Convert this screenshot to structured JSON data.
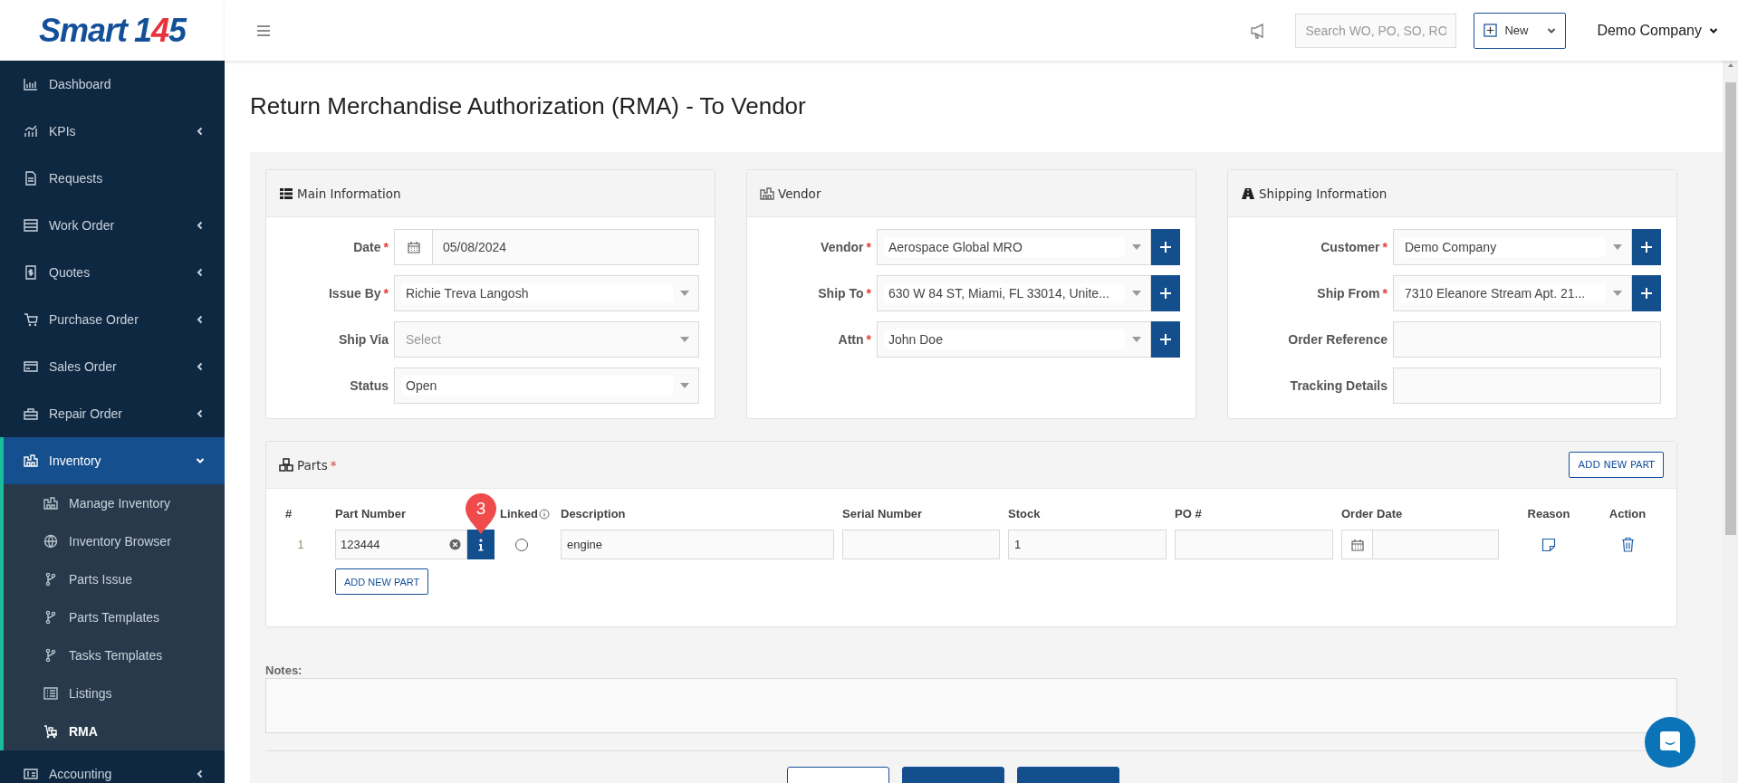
{
  "logo": {
    "word": "Smart",
    "number": "145"
  },
  "sidebar": {
    "items": [
      {
        "label": "Dashboard",
        "has_submenu": false,
        "selected": false
      },
      {
        "label": "KPIs",
        "has_submenu": true,
        "expanded": false,
        "selected": false
      },
      {
        "label": "Requests",
        "has_submenu": false,
        "selected": false
      },
      {
        "label": "Work Order",
        "has_submenu": true,
        "expanded": false,
        "selected": false
      },
      {
        "label": "Quotes",
        "has_submenu": true,
        "expanded": false,
        "selected": false
      },
      {
        "label": "Purchase Order",
        "has_submenu": true,
        "expanded": false,
        "selected": false
      },
      {
        "label": "Sales Order",
        "has_submenu": true,
        "expanded": false,
        "selected": false
      },
      {
        "label": "Repair Order",
        "has_submenu": true,
        "expanded": false,
        "selected": false
      },
      {
        "label": "Inventory",
        "has_submenu": true,
        "expanded": true,
        "selected": true,
        "children": [
          {
            "label": "Manage Inventory",
            "selected": false
          },
          {
            "label": "Inventory Browser",
            "selected": false
          },
          {
            "label": "Parts Issue",
            "selected": false
          },
          {
            "label": "Parts Templates",
            "selected": false
          },
          {
            "label": "Tasks Templates",
            "selected": false
          },
          {
            "label": "Listings",
            "selected": false
          },
          {
            "label": "RMA",
            "selected": true
          }
        ]
      },
      {
        "label": "Accounting",
        "has_submenu": true,
        "expanded": false,
        "selected": false
      }
    ]
  },
  "topbar": {
    "search": {
      "placeholder": "Search WO, PO, SO, RO"
    },
    "new_button": "New",
    "company": "Demo Company"
  },
  "page_title": "Return Merchandise Authorization (RMA) - To Vendor",
  "sections": [
    {
      "title": "Main Information",
      "fields": [
        {
          "label": "Date",
          "required_mark": "*",
          "kind": "date",
          "value": "05/08/2024",
          "has_add": false
        },
        {
          "label": "Issue By",
          "required_mark": "*",
          "kind": "select",
          "value": "Richie Treva Langosh",
          "has_add": false
        },
        {
          "label": "Ship Via",
          "kind": "select",
          "placeholder": "Select",
          "has_add": false
        },
        {
          "label": "Status",
          "kind": "select",
          "value": "Open",
          "has_add": false
        }
      ]
    },
    {
      "title": "Vendor",
      "fields": [
        {
          "label": "Vendor",
          "required_mark": "*",
          "kind": "select",
          "value": "Aerospace Global MRO",
          "has_add": true
        },
        {
          "label": "Ship To",
          "required_mark": "*",
          "kind": "select",
          "value": "630 W 84 ST, Miami, FL 33014, Unite...",
          "has_add": true
        },
        {
          "label": "Attn",
          "required_mark": "*",
          "kind": "select",
          "value": "John Doe",
          "has_add": true
        }
      ]
    },
    {
      "title": "Shipping Information",
      "fields": [
        {
          "label": "Customer",
          "required_mark": "*",
          "kind": "select",
          "value": "Demo Company",
          "has_add": true
        },
        {
          "label": "Ship From",
          "required_mark": "*",
          "kind": "select",
          "value": "7310 Eleanore Stream Apt. 21...",
          "has_add": true
        },
        {
          "label": "Order Reference",
          "kind": "text",
          "has_add": false
        },
        {
          "label": "Tracking Details",
          "kind": "text",
          "has_add": false
        }
      ]
    }
  ],
  "parts": {
    "title": "Parts",
    "required_mark": "*",
    "add_button": "ADD NEW PART",
    "columns": [
      "#",
      "Part Number",
      "Linked",
      "Description",
      "Serial Number",
      "Stock",
      "PO #",
      "Order Date",
      "Reason",
      "Action"
    ],
    "rows": [
      {
        "number": "1",
        "part_number": "123444",
        "linked": false,
        "description": "engine",
        "stock": "1"
      }
    ],
    "add_row_button": "ADD NEW PART",
    "step_marker": "3"
  },
  "notes": {
    "label": "Notes:"
  },
  "footer_buttons": [
    {
      "kind": "outline"
    },
    {
      "kind": "primary"
    },
    {
      "kind": "primary"
    }
  ]
}
